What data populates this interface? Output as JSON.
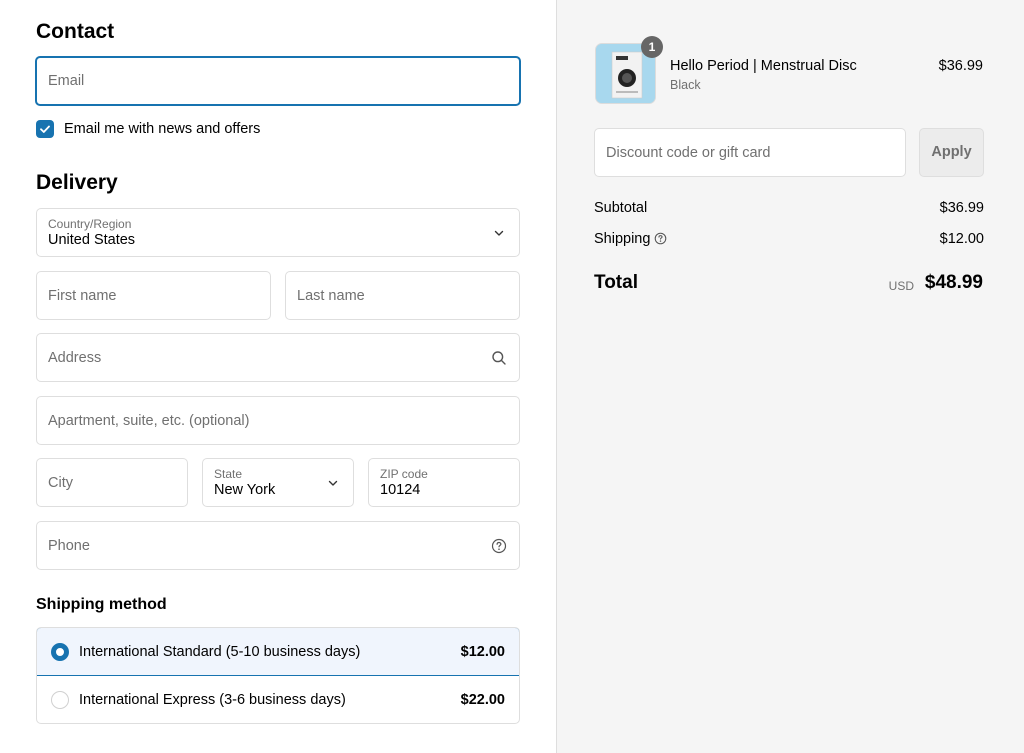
{
  "contact": {
    "heading": "Contact",
    "email_placeholder": "Email",
    "newsletter_label": "Email me with news and offers",
    "newsletter_checked": true
  },
  "delivery": {
    "heading": "Delivery",
    "country_label": "Country/Region",
    "country_value": "United States",
    "first_name_placeholder": "First name",
    "last_name_placeholder": "Last name",
    "address_placeholder": "Address",
    "apartment_placeholder": "Apartment, suite, etc. (optional)",
    "city_placeholder": "City",
    "state_label": "State",
    "state_value": "New York",
    "zip_label": "ZIP code",
    "zip_value": "10124",
    "phone_placeholder": "Phone"
  },
  "shipping_method": {
    "heading": "Shipping method",
    "options": [
      {
        "name": "International Standard (5-10 business days)",
        "price": "$12.00",
        "selected": true
      },
      {
        "name": "International Express (3-6 business days)",
        "price": "$22.00",
        "selected": false
      }
    ]
  },
  "summary": {
    "product": {
      "name": "Hello Period | Menstrual Disc",
      "variant": "Black",
      "price": "$36.99",
      "quantity": "1"
    },
    "discount_placeholder": "Discount code or gift card",
    "apply_label": "Apply",
    "subtotal_label": "Subtotal",
    "subtotal_value": "$36.99",
    "shipping_label": "Shipping",
    "shipping_value": "$12.00",
    "total_label": "Total",
    "total_currency": "USD",
    "total_value": "$48.99"
  },
  "colors": {
    "accent": "#1773b0",
    "summary_bg": "#f5f5f5",
    "selected_shipping_bg": "#f0f5fd"
  }
}
